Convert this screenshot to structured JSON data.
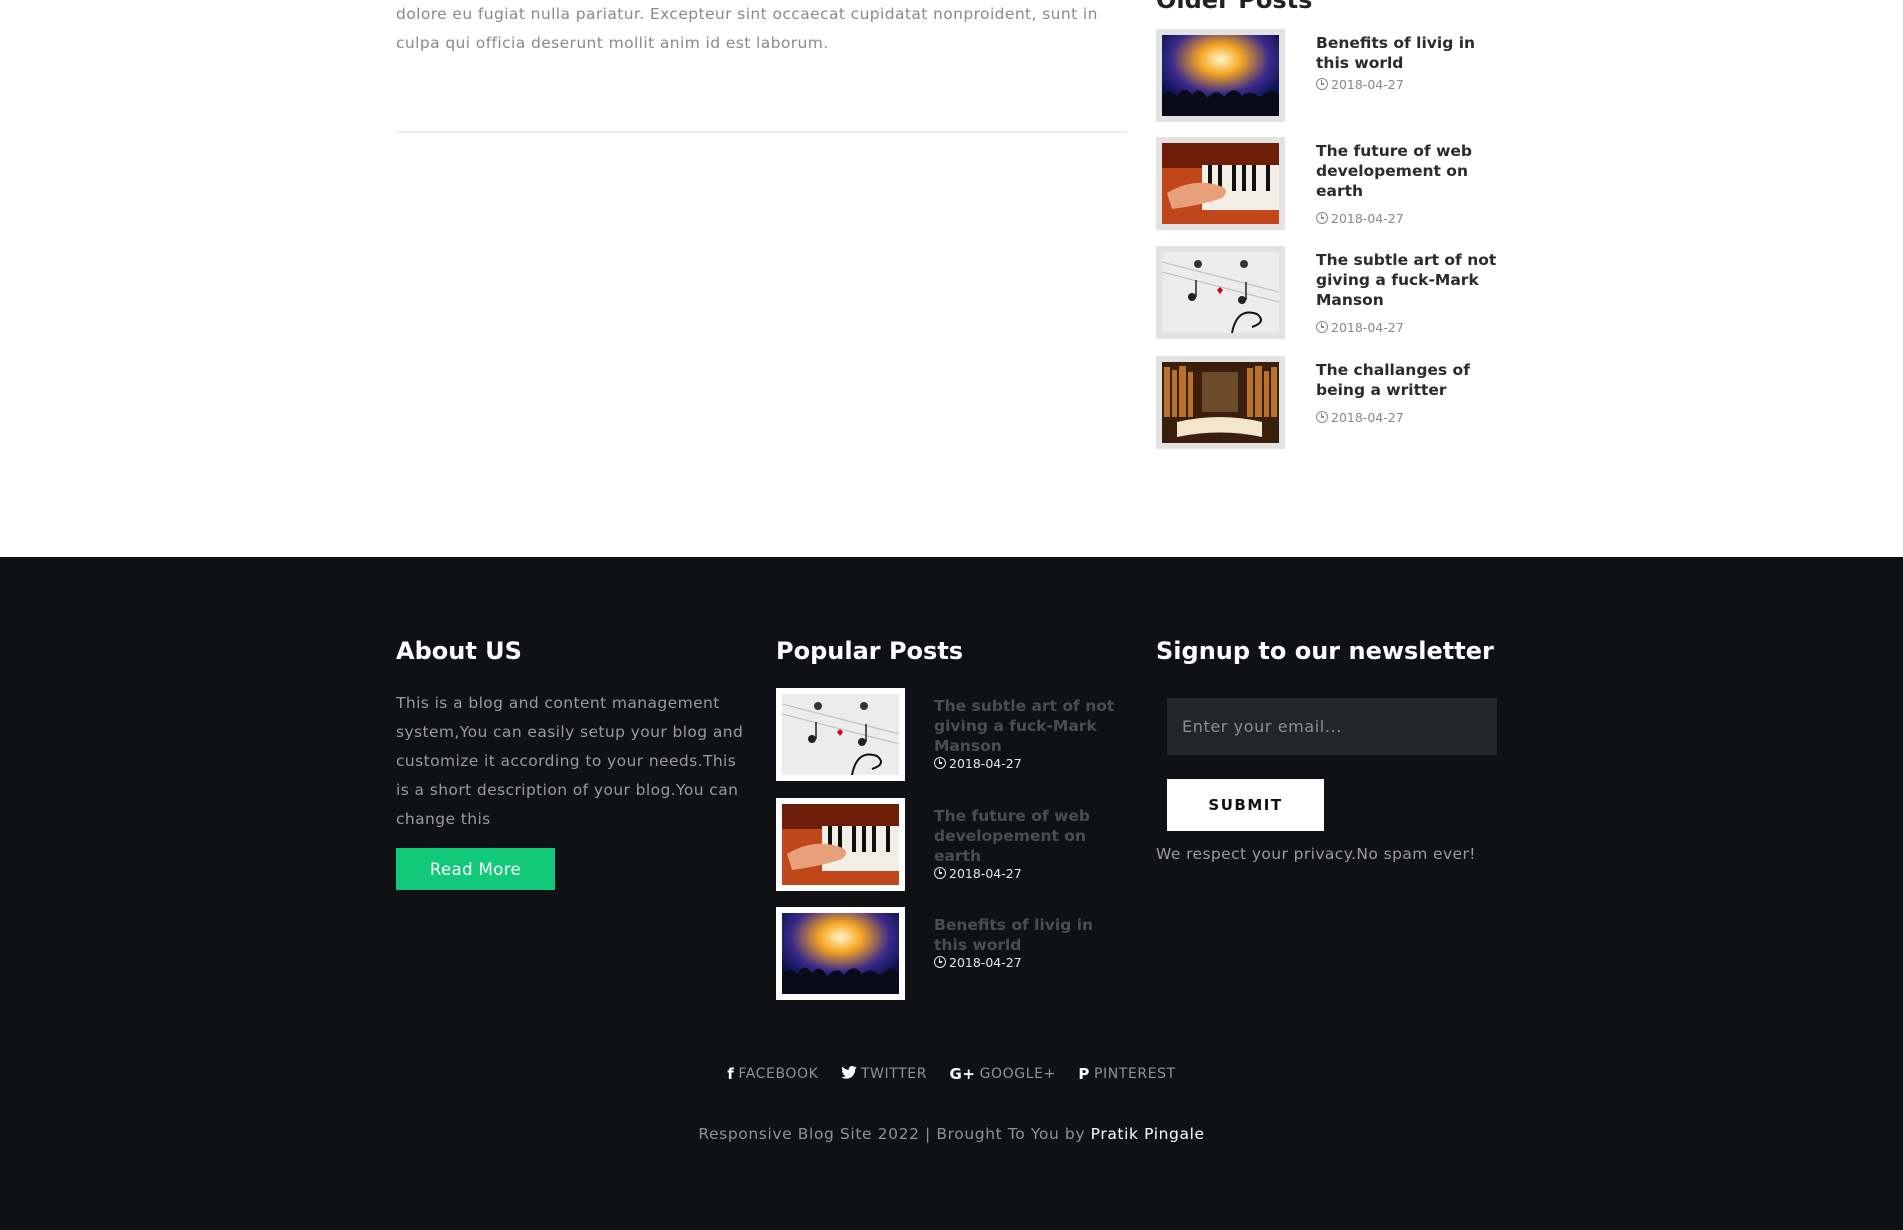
{
  "article": {
    "tail_text": "dolore eu fugiat nulla pariatur. Excepteur sint occaecat cupidatat nonproident, sunt in culpa qui officia deserunt mollit anim id est laborum."
  },
  "sidebar": {
    "title": "Older Posts",
    "posts": [
      {
        "title": "Benefits of livig in this world",
        "date": "2018-04-27",
        "image": "concert"
      },
      {
        "title": "The future of web developement on earth",
        "date": "2018-04-27",
        "image": "piano"
      },
      {
        "title": "The subtle art of not giving a fuck-Mark Manson",
        "date": "2018-04-27",
        "image": "music-notes"
      },
      {
        "title": "The challanges of being a writter",
        "date": "2018-04-27",
        "image": "books"
      }
    ]
  },
  "footer": {
    "about": {
      "heading": "About US",
      "text": "This is a blog and content management system,You can easily setup your blog and customize it according to your needs.This is a short description of your blog.You can change this",
      "button_label": "Read More",
      "button_color": "#12c97a"
    },
    "popular": {
      "heading": "Popular Posts",
      "posts": [
        {
          "title": "The subtle art of not giving a fuck-Mark Manson",
          "date": "2018-04-27",
          "image": "music-notes"
        },
        {
          "title": "The future of web developement on earth",
          "date": "2018-04-27",
          "image": "piano"
        },
        {
          "title": "Benefits of livig in this world",
          "date": "2018-04-27",
          "image": "concert"
        }
      ]
    },
    "newsletter": {
      "heading": "Signup to our newsletter",
      "email_placeholder": "Enter your email...",
      "submit_label": "SUBMIT",
      "privacy_note": "We respect your privacy.No spam ever!"
    },
    "social": [
      {
        "icon": "facebook-icon",
        "glyph": "f",
        "label": "FACEBOOK"
      },
      {
        "icon": "twitter-icon",
        "glyph": "🐦",
        "label": "TWITTER"
      },
      {
        "icon": "google-plus-icon",
        "glyph": "G+",
        "label": "GOOGLE+"
      },
      {
        "icon": "pinterest-icon",
        "glyph": "P",
        "label": "PINTEREST"
      }
    ],
    "credits": {
      "text": "Responsive Blog Site 2022 | Brought To You by ",
      "author": "Pratik Pingale"
    },
    "background_color": "#101114"
  }
}
